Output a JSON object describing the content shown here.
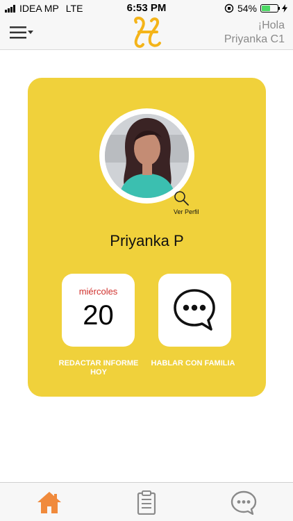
{
  "status_bar": {
    "carrier": "IDEA MP",
    "network": "LTE",
    "time": "6:53 PM",
    "battery": "54%",
    "battery_level": 0.54,
    "battery_color": "#4cd964"
  },
  "header": {
    "menu_icon": "hamburger-menu-icon",
    "logo": "app-logo",
    "greeting_line1": "¡Hola",
    "greeting_line2": "Priyanka C1"
  },
  "profile": {
    "name": "Priyanka P",
    "view_profile_label": "Ver Perfil",
    "view_profile_icon": "search-icon"
  },
  "actions": {
    "calendar": {
      "weekday": "miércoles",
      "day": "20",
      "label": "REDACTAR INFORME HOY"
    },
    "chat": {
      "icon": "chat-bubble-icon",
      "label": "HABLAR CON FAMILIA"
    }
  },
  "tab_bar": {
    "tabs": [
      {
        "icon": "home-icon",
        "active": true
      },
      {
        "icon": "clipboard-icon",
        "active": false
      },
      {
        "icon": "chat-icon",
        "active": false
      }
    ],
    "active_color": "#f08a3c",
    "inactive_color": "#8a8a8a"
  },
  "colors": {
    "card_bg": "#f0d13b",
    "weekday_red": "#d0312d"
  }
}
